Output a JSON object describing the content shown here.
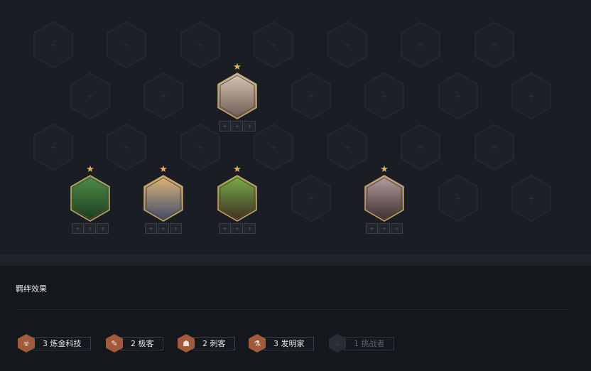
{
  "board": {
    "champions": [
      {
        "id": "row0-slot2",
        "stars": "★",
        "colors": [
          "#d8c8b8",
          "#6b5a52"
        ],
        "items": [
          "+",
          "+",
          "+"
        ]
      },
      {
        "id": "row2-slot0",
        "stars": "★",
        "colors": [
          "#4f8f4a",
          "#1d3a1e"
        ],
        "items": [
          "+",
          "+",
          "+"
        ]
      },
      {
        "id": "row2-slot1",
        "stars": "★",
        "colors": [
          "#e0b878",
          "#3c4a6a"
        ],
        "items": [
          "+",
          "+",
          "+"
        ]
      },
      {
        "id": "row2-slot2",
        "stars": "★",
        "colors": [
          "#79b04c",
          "#3e2c22"
        ],
        "items": [
          "+",
          "+",
          "+"
        ]
      },
      {
        "id": "row2-slot4",
        "stars": "★",
        "colors": [
          "#b8a0a0",
          "#3a2c2c"
        ],
        "items": [
          "+",
          "+",
          "+"
        ]
      }
    ],
    "empty_slot_symbol": "+"
  },
  "panel": {
    "title": "羁绊效果"
  },
  "traits": [
    {
      "label": "3 炼金科技",
      "icon": "chemtech-icon",
      "glyph": "☣",
      "color": "#a15a3c",
      "active": true
    },
    {
      "label": "2 极客",
      "icon": "yordle-scrap-icon",
      "glyph": "✎",
      "color": "#a15a3c",
      "active": true
    },
    {
      "label": "2 刺客",
      "icon": "assassin-icon",
      "glyph": "☗",
      "color": "#a15a3c",
      "active": true
    },
    {
      "label": "3 发明家",
      "icon": "innovator-icon",
      "glyph": "⚗",
      "color": "#a15a3c",
      "active": true
    },
    {
      "label": "1 挑战者",
      "icon": "challenger-icon",
      "glyph": "⚔",
      "color": "#2a2e34",
      "active": false
    }
  ]
}
